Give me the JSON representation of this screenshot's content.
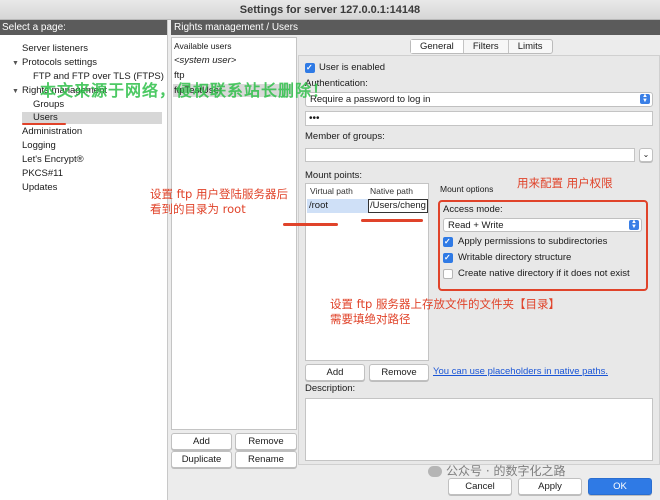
{
  "window": {
    "title": "Settings for server 127.0.0.1:14148"
  },
  "left": {
    "header": "Select a page:",
    "items": [
      {
        "label": "Server listeners"
      },
      {
        "label": "Protocols settings"
      },
      {
        "label": "FTP and FTP over TLS (FTPS)"
      },
      {
        "label": "Rights management"
      },
      {
        "label": "Groups"
      },
      {
        "label": "Users"
      },
      {
        "label": "Administration"
      },
      {
        "label": "Logging"
      },
      {
        "label": "Let's Encrypt®"
      },
      {
        "label": "PKCS#11"
      },
      {
        "label": "Updates"
      }
    ]
  },
  "right_header": "Rights management / Users",
  "users": {
    "title": "Available users",
    "items": [
      "<system user>",
      "ftp",
      "ftpTestUser"
    ],
    "buttons": {
      "add": "Add",
      "remove": "Remove",
      "duplicate": "Duplicate",
      "rename": "Rename"
    }
  },
  "tabs": [
    "General",
    "Filters",
    "Limits"
  ],
  "general": {
    "enabled_label": "User is enabled",
    "auth_label": "Authentication:",
    "auth_value": "Require a password to log in",
    "password_value": "•••",
    "groups_label": "Member of groups:",
    "mount_label": "Mount points:",
    "mount_cols": {
      "virtual": "Virtual path",
      "native": "Native path"
    },
    "mount_row": {
      "virtual": "/root",
      "native": "/Users/cheng"
    },
    "mount_options": "Mount options",
    "access_mode_label": "Access mode:",
    "access_mode_value": "Read + Write",
    "opt_apply": "Apply permissions to subdirectories",
    "opt_writable": "Writable directory structure",
    "opt_create": "Create native directory if it does not exist",
    "mount_add": "Add",
    "mount_remove": "Remove",
    "placeholder_link": "You can use placeholders in native paths.",
    "description_label": "Description:"
  },
  "footer": {
    "cancel": "Cancel",
    "apply": "Apply",
    "ok": "OK"
  },
  "annotations": {
    "virtual_note_1": "设置 ftp 用户登陆服务器后",
    "virtual_note_2": "看到的目录为 root",
    "rights_note": "用来配置 用户权限",
    "native_note_1": "设置 ftp 服务器上存放文件的文件夹【目录】",
    "native_note_2": "需要填绝对路径"
  },
  "watermark": "本文来源于网络，侵权联系站长删除！",
  "wechat": "公众号 · 的数字化之路",
  "colors": {
    "accent": "#2f7ae5",
    "annotation": "#e0432a",
    "watermark": "#2fc04a"
  }
}
